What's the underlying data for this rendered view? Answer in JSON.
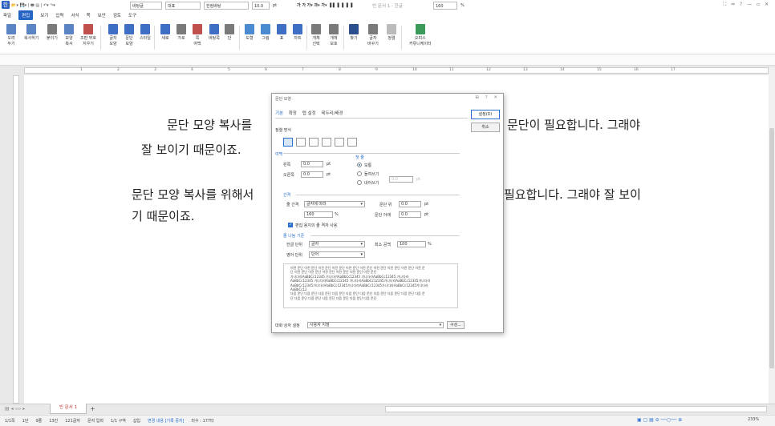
{
  "window": {
    "title": "빈 문서 1 - 한글",
    "controls": "⛶ ⇔ ? — ▫ ✕"
  },
  "menu": [
    "파일",
    "편집",
    "보기",
    "입력",
    "서식",
    "쪽",
    "보안",
    "검토",
    "도구"
  ],
  "menu_active": "편집",
  "ribbon": [
    {
      "label": "오려\n두기",
      "color": "#5b84c4"
    },
    {
      "label": "복사하기",
      "color": "#5b84c4"
    },
    {
      "label": "붙이기",
      "color": "#7a7a7a"
    },
    {
      "label": "모양\n복사",
      "color": "#5b84c4"
    },
    {
      "label": "조판 부호\n지우기",
      "color": "#c0504d"
    },
    {
      "label": "글자\n모양",
      "color": "#3f6fc4"
    },
    {
      "label": "문단\n모양",
      "color": "#3f6fc4"
    },
    {
      "label": "스타일",
      "color": "#3f6fc4"
    },
    {
      "label": "새로",
      "color": "#3f6fc4"
    },
    {
      "label": "가로",
      "color": "#7a7a7a"
    },
    {
      "label": "쪽\n여백",
      "color": "#c0504d"
    },
    {
      "label": "바탕쪽",
      "color": "#3f6fc4"
    },
    {
      "label": "단",
      "color": "#7a7a7a"
    },
    {
      "label": "도형",
      "color": "#4a8ad0"
    },
    {
      "label": "그림",
      "color": "#4a8ad0"
    },
    {
      "label": "표",
      "color": "#3f6fc4"
    },
    {
      "label": "차트",
      "color": "#3f6fc4"
    },
    {
      "label": "개체\n선택",
      "color": "#7a7a7a"
    },
    {
      "label": "개체\n보호",
      "color": "#7a7a7a"
    },
    {
      "label": "찾기",
      "color": "#2a4f8c"
    },
    {
      "label": "글자\n바꾸기",
      "color": "#7a7a7a"
    },
    {
      "label": "정렬",
      "color": "#bbbbbb"
    },
    {
      "label": "오피스\n커뮤니케이터",
      "color": "#3a9a5a"
    }
  ],
  "format": {
    "style": "바탕글",
    "lang": "대표",
    "font": "한컴바탕",
    "size": "10.0",
    "unit": "pt",
    "zoom": "160",
    "pct": "%"
  },
  "ruler_marks": [
    "1",
    "2",
    "3",
    "4",
    "5",
    "6",
    "7",
    "8",
    "9",
    "10",
    "11",
    "12",
    "13",
    "14",
    "15",
    "16",
    "17"
  ],
  "document": {
    "l1a": "문단 모양 복사를",
    "l1b": "문단이 필요합니다. 그래야",
    "l2": "잘 보이기 때문이죠.",
    "l3a": "문단 모양 복사를 위해서",
    "l3b": "필요합니다. 그래야 잘 보이",
    "l4": "기 때문이죠."
  },
  "dialog": {
    "title": "문단 모양",
    "controls": "⊞ ? ✕",
    "tabs": [
      "기본",
      "확장",
      "탭 설정",
      "테두리/배경"
    ],
    "ok": "설정(D)",
    "cancel": "취소",
    "align_section": "정렬 방식",
    "margin_section": "여백",
    "left_label": "왼쪽",
    "left_val": "0.0",
    "right_label": "오른쪽",
    "right_val": "0.0",
    "unit": "pt",
    "first_section": "첫 줄",
    "first_opts": [
      "보통",
      "들여쓰기",
      "내어쓰기"
    ],
    "first_val": "0.0",
    "spacing_section": "간격",
    "line_label": "줄 간격",
    "line_type": "글자에 따라",
    "line_val": "160",
    "pct": "%",
    "above_label": "문단 위",
    "above_val": "0.0",
    "below_label": "문단 아래",
    "below_val": "0.0",
    "grid_chk": "편집 용지의 줄 격자 사용",
    "wrap_section": "줄 나눔 기준",
    "han_label": "한글 단위",
    "han_val": "글자",
    "eng_label": "영어 단위",
    "eng_val": "단어",
    "minsp_label": "최소 공백",
    "minsp_val": "100",
    "preview": [
      "이전 문단 이전 문단 이전 문단 이전 문단 이전 문단 이전 문단 이전 문단 이전 문단 이전 문단 이전 문",
      "단 이전 문단 이전 문단 이전 문단 이전 문단 이전 문단 이전 문단",
      "가나다라AaBbCc12345   가나다라AaBbCc12345   가나다라AaBbCc12345   가나다라",
      "AaBbCc12345 가나다라AaBbCc12345 가나다라AaBbCc12345가나다라AaBbCc12345가나다라",
      "AaBbCc12345가나다라AaBbCc12345가나다라AaBbCc12345가나다라AaBbCc12345가나다라",
      "AaBbCc12",
      "다음 문단 다음 문단 다음 문단 다음 문단 다음 문단 다음 문단 다음 문단 다음 문단 다음 문단 다음 문",
      "단 다음 문단 다음 문단 다음 문단 다음 문단 다음 문단 다음 문단"
    ],
    "dlgset_label": "대화 상자 설정",
    "dlgset_val": "사용자 지정",
    "config": "구성..."
  },
  "tab": {
    "name": "빈 문서 1",
    "add": "+"
  },
  "status": {
    "items": [
      "1/1쪽",
      "1단",
      "9줄",
      "13칸",
      "121글자",
      "문자 입력",
      "1/1 구역",
      "삽입"
    ],
    "change": "변경 내용 [기록 중지]",
    "typing": "타수 : 177타",
    "zoom": "233%"
  }
}
